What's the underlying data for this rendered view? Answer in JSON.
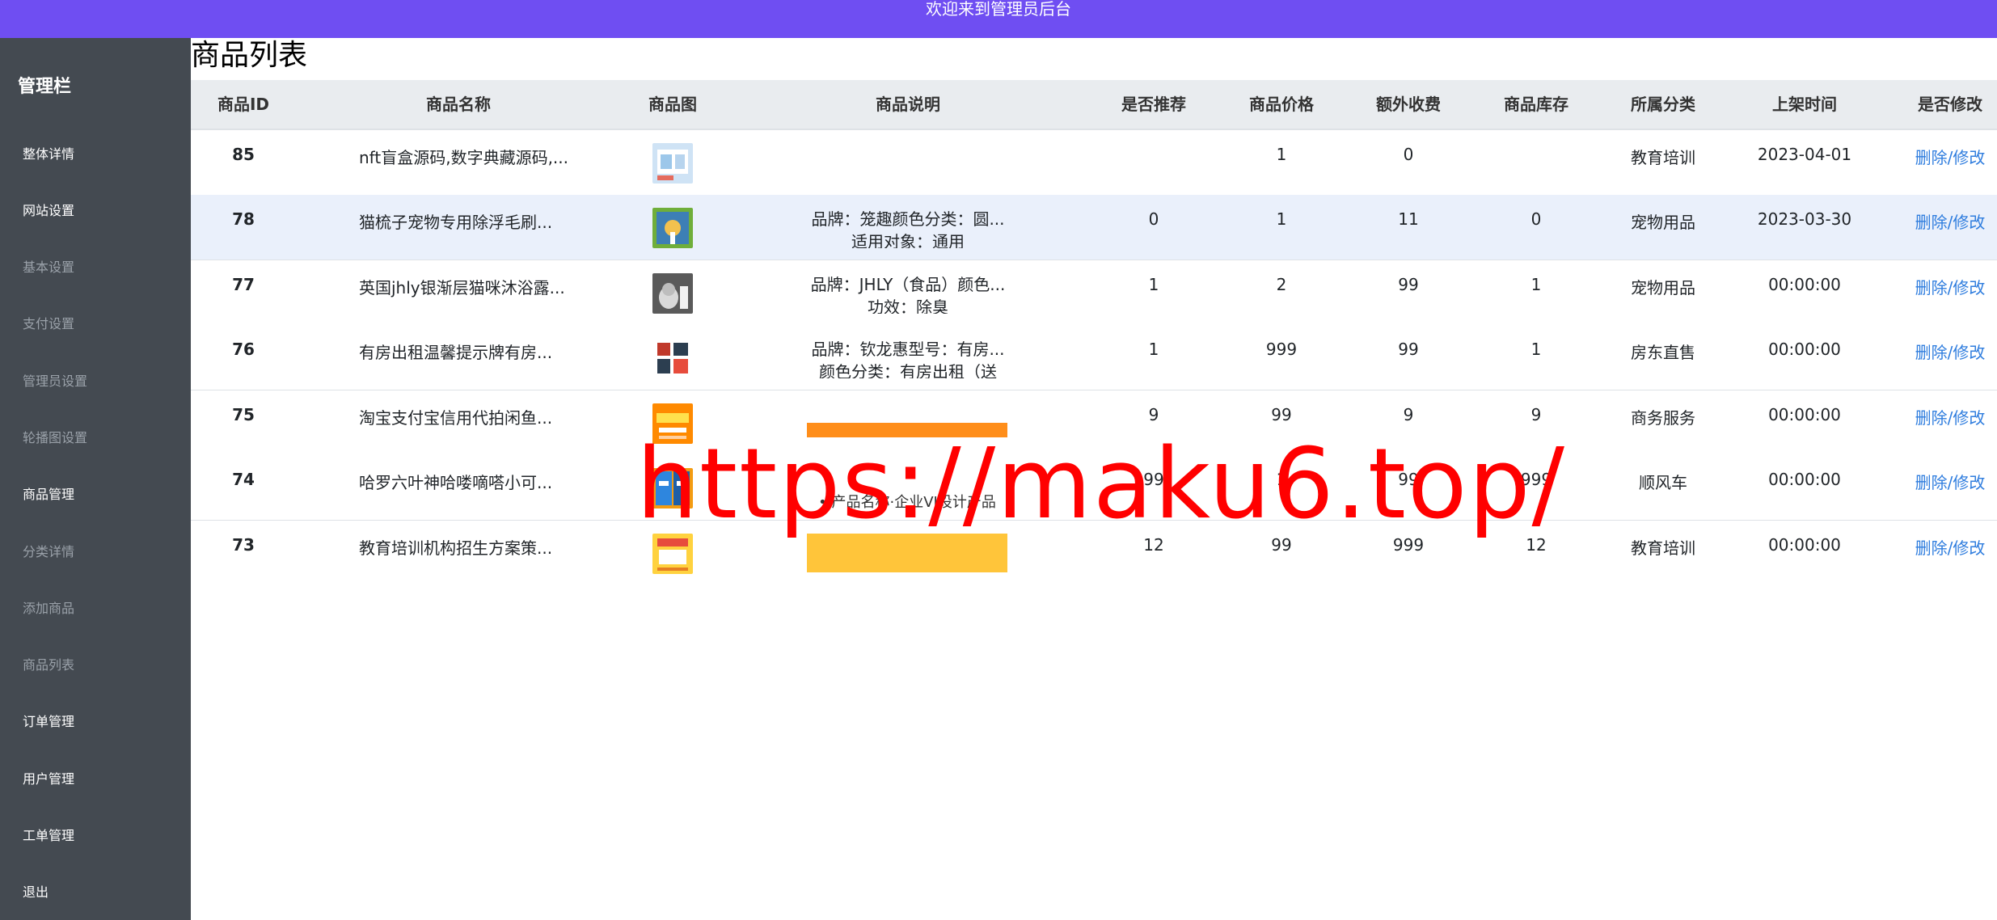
{
  "topbar": {
    "title": "欢迎来到管理员后台"
  },
  "sidebar": {
    "title": "管理栏",
    "items": [
      {
        "label": "整体详情",
        "bright": true
      },
      {
        "label": "网站设置",
        "bright": true
      },
      {
        "label": "基本设置",
        "bright": false
      },
      {
        "label": "支付设置",
        "bright": false
      },
      {
        "label": "管理员设置",
        "bright": false
      },
      {
        "label": "轮播图设置",
        "bright": false
      },
      {
        "label": "商品管理",
        "bright": true
      },
      {
        "label": "分类详情",
        "bright": false
      },
      {
        "label": "添加商品",
        "bright": false
      },
      {
        "label": "商品列表",
        "bright": false
      },
      {
        "label": "订单管理",
        "bright": true
      },
      {
        "label": "用户管理",
        "bright": true
      },
      {
        "label": "工单管理",
        "bright": true
      },
      {
        "label": "退出",
        "bright": true
      }
    ]
  },
  "main": {
    "title": "商品列表",
    "columns": [
      "商品ID",
      "商品名称",
      "商品图",
      "商品说明",
      "是否推荐",
      "商品价格",
      "额外收费",
      "商品库存",
      "所属分类",
      "上架时间",
      "是否修改"
    ],
    "rows": [
      {
        "id": "85",
        "name": "nft盲盒源码,数字典藏源码,...",
        "desc1": "",
        "desc2": "",
        "recommend": "",
        "price": "1",
        "fee": "0",
        "stock": "",
        "category": "教育培训",
        "time": "2023-04-01",
        "action": "删除/修改"
      },
      {
        "id": "78",
        "name": "猫梳子宠物专用除浮毛刷...",
        "desc1": "品牌：笼趣颜色分类：圆...",
        "desc2": "适用对象：通用",
        "recommend": "0",
        "price": "1",
        "fee": "11",
        "stock": "0",
        "category": "宠物用品",
        "time": "2023-03-30",
        "action": "删除/修改"
      },
      {
        "id": "77",
        "name": "英国jhly银渐层猫咪沐浴露...",
        "desc1": "品牌：JHLY（食品）颜色...",
        "desc2": "功效：除臭",
        "recommend": "1",
        "price": "2",
        "fee": "99",
        "stock": "1",
        "category": "宠物用品",
        "time": "00:00:00",
        "action": "删除/修改"
      },
      {
        "id": "76",
        "name": "有房出租温馨提示牌有房...",
        "desc1": "品牌：钦龙惠型号：有房...",
        "desc2": "颜色分类：有房出租（送",
        "recommend": "1",
        "price": "999",
        "fee": "99",
        "stock": "1",
        "category": "房东直售",
        "time": "00:00:00",
        "action": "删除/修改"
      },
      {
        "id": "75",
        "name": "淘宝支付宝信用代拍闲鱼...",
        "desc1": "",
        "desc2": "",
        "recommend": "9",
        "price": "99",
        "fee": "9",
        "stock": "9",
        "category": "商务服务",
        "time": "00:00:00",
        "action": "删除/修改"
      },
      {
        "id": "74",
        "name": "哈罗六叶神哈喽嘀嗒小可...",
        "desc1": "",
        "desc2": "",
        "recommend": "99",
        "price": "1",
        "fee": "99",
        "stock": "999",
        "category": "顺风车",
        "time": "00:00:00",
        "action": "删除/修改"
      },
      {
        "id": "73",
        "name": "教育培训机构招生方案策...",
        "desc1": "",
        "desc2": "",
        "recommend": "12",
        "price": "99",
        "fee": "999",
        "stock": "12",
        "category": "教育培训",
        "time": "00:00:00",
        "action": "删除/修改"
      }
    ],
    "banner_text": "• 产品名称·企业VI设计产品"
  },
  "watermark": "https://maku6.top/",
  "colors": {
    "topbar": "#6f4ef2",
    "sidebar": "#444a51",
    "link": "#2f7dde",
    "watermark": "#ff0000"
  }
}
